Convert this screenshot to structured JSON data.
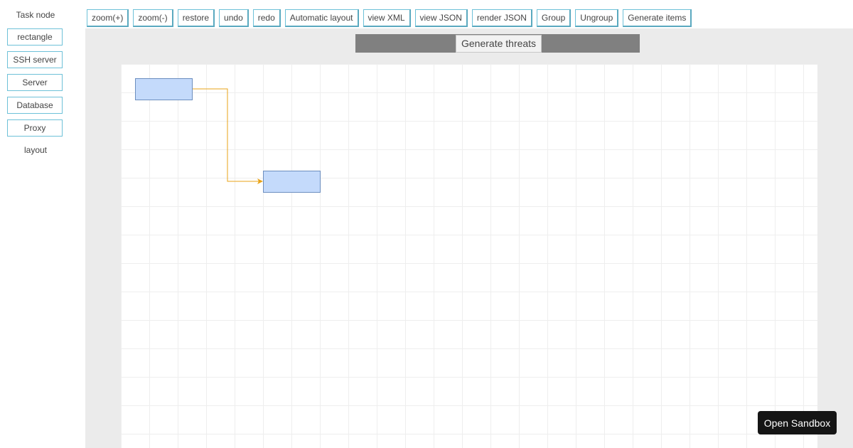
{
  "sidebar": {
    "title": "Task node",
    "items": [
      {
        "label": "rectangle"
      },
      {
        "label": "SSH server"
      },
      {
        "label": "Server"
      },
      {
        "label": "Database"
      },
      {
        "label": "Proxy"
      }
    ],
    "layout_label": "layout"
  },
  "toolbar": {
    "buttons": [
      {
        "label": "zoom(+)"
      },
      {
        "label": "zoom(-)"
      },
      {
        "label": "restore"
      },
      {
        "label": "undo"
      },
      {
        "label": "redo"
      },
      {
        "label": "Automatic layout"
      },
      {
        "label": "view XML"
      },
      {
        "label": "view JSON"
      },
      {
        "label": "render JSON"
      },
      {
        "label": "Group"
      },
      {
        "label": "Ungroup"
      },
      {
        "label": "Generate items"
      }
    ]
  },
  "workspace": {
    "generate_threats_label": "Generate threats"
  },
  "diagram": {
    "nodes": [
      {
        "id": "node-1",
        "fill": "#c4dafb",
        "stroke": "#6c8ebf"
      },
      {
        "id": "node-2",
        "fill": "#c4dafb",
        "stroke": "#6c8ebf"
      }
    ],
    "edges": [
      {
        "from": "node-1",
        "to": "node-2",
        "color": "#e8a317"
      }
    ]
  },
  "sandbox": {
    "label": "Open Sandbox"
  },
  "colors": {
    "accent_border": "#6ec1d8",
    "workspace_bg": "#ebebeb",
    "threat_bar": "#808080"
  }
}
